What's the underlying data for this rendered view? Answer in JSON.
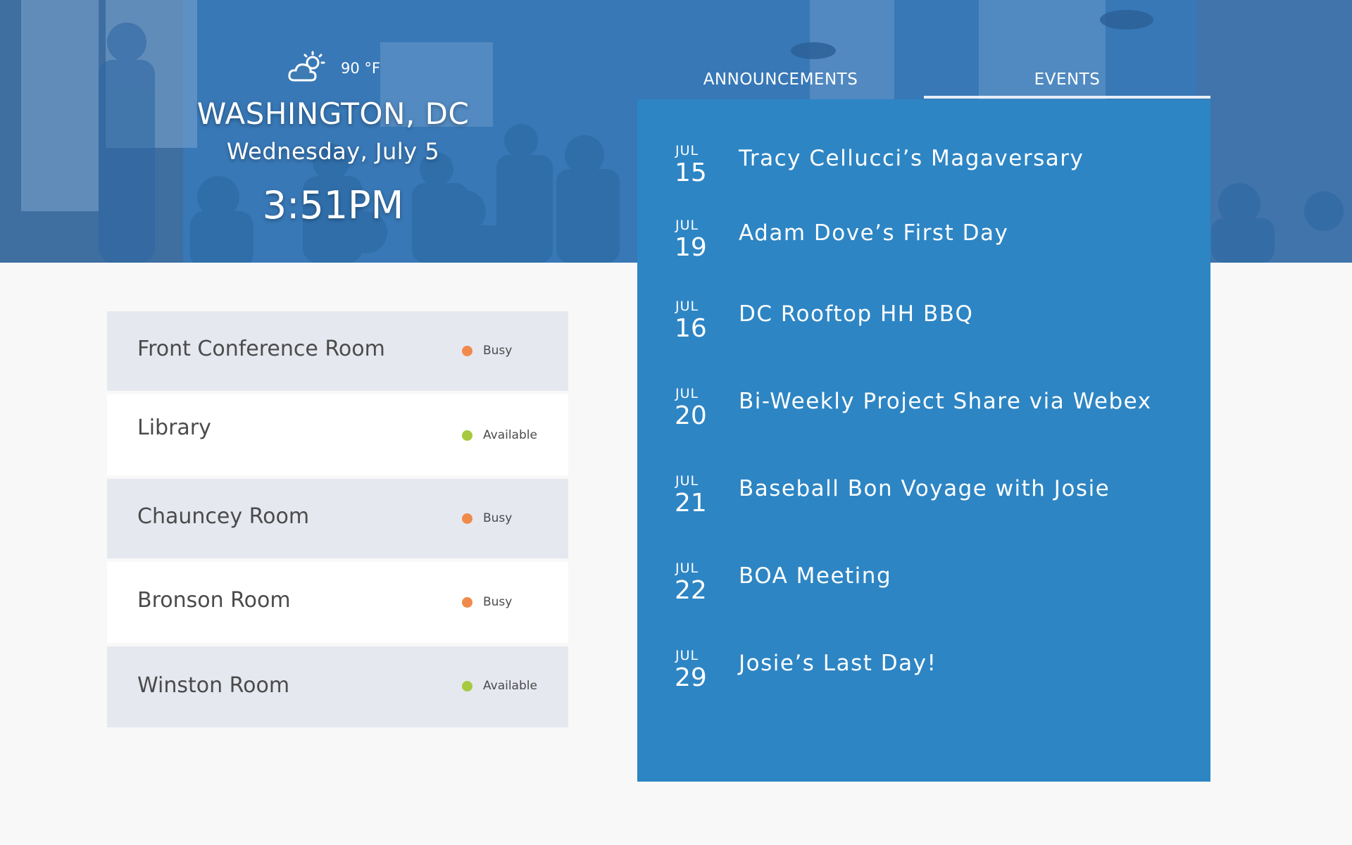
{
  "header": {
    "temperature": "90 °F",
    "city": "WASHINGTON, DC",
    "date": "Wednesday, July 5",
    "time": "3:51PM",
    "weather_icon": "partly-sunny-icon"
  },
  "tabs": [
    {
      "label": "ANNOUNCEMENTS",
      "active": false
    },
    {
      "label": "EVENTS",
      "active": true
    }
  ],
  "rooms": [
    {
      "name": "Front Conference Room",
      "status": "Busy",
      "status_color": "#f08a4b"
    },
    {
      "name": "Library",
      "status": "Available",
      "status_color": "#a6c940"
    },
    {
      "name": "Chauncey Room",
      "status": "Busy",
      "status_color": "#f08a4b"
    },
    {
      "name": "Bronson Room",
      "status": "Busy",
      "status_color": "#f08a4b"
    },
    {
      "name": "Winston Room",
      "status": "Available",
      "status_color": "#a6c940"
    }
  ],
  "events": [
    {
      "month": "JUL",
      "day": "15",
      "title": "Tracy Cellucci’s Magaversary"
    },
    {
      "month": "JUL",
      "day": "19",
      "title": "Adam Dove’s First Day"
    },
    {
      "month": "JUL",
      "day": "16",
      "title": "DC Rooftop HH BBQ"
    },
    {
      "month": "JUL",
      "day": "20",
      "title": "Bi-Weekly Project Share via Webex"
    },
    {
      "month": "JUL",
      "day": "21",
      "title": "Baseball Bon Voyage with Josie"
    },
    {
      "month": "JUL",
      "day": "22",
      "title": "BOA Meeting"
    },
    {
      "month": "JUL",
      "day": "29",
      "title": "Josie’s Last Day!"
    }
  ],
  "colors": {
    "accent": "#2d85c4",
    "busy": "#f08a4b",
    "available": "#a6c940"
  }
}
